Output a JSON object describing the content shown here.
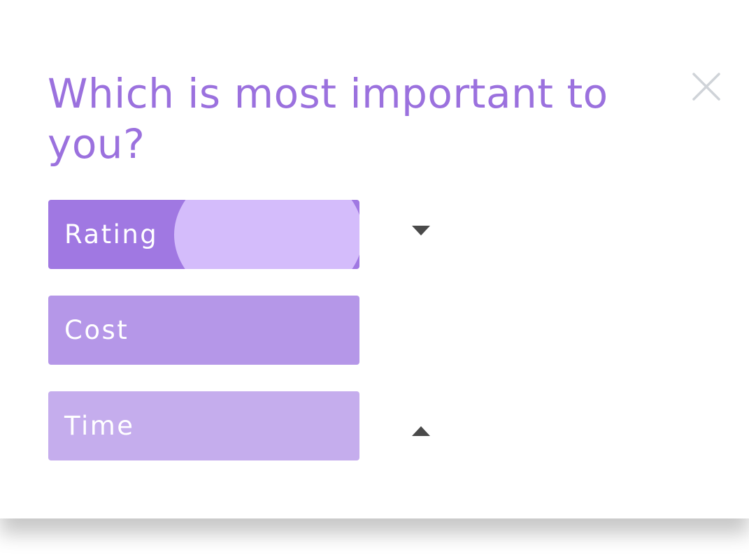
{
  "dialog": {
    "title": "Which is most important to you?",
    "close_icon": "close-icon"
  },
  "options": [
    {
      "label": "Rating",
      "color": "#a078e2",
      "state": "pressed"
    },
    {
      "label": "Cost",
      "color": "#b597e8",
      "state": "default"
    },
    {
      "label": "Time",
      "color": "#c5aded",
      "state": "default"
    }
  ],
  "controls": {
    "move_down_icon": "triangle-down-icon",
    "move_up_icon": "triangle-up-icon"
  },
  "colors": {
    "accent": "#9b71de",
    "ripple": "#d4bcfb",
    "close": "#cfd3d8",
    "arrow": "#4a4a4a"
  }
}
